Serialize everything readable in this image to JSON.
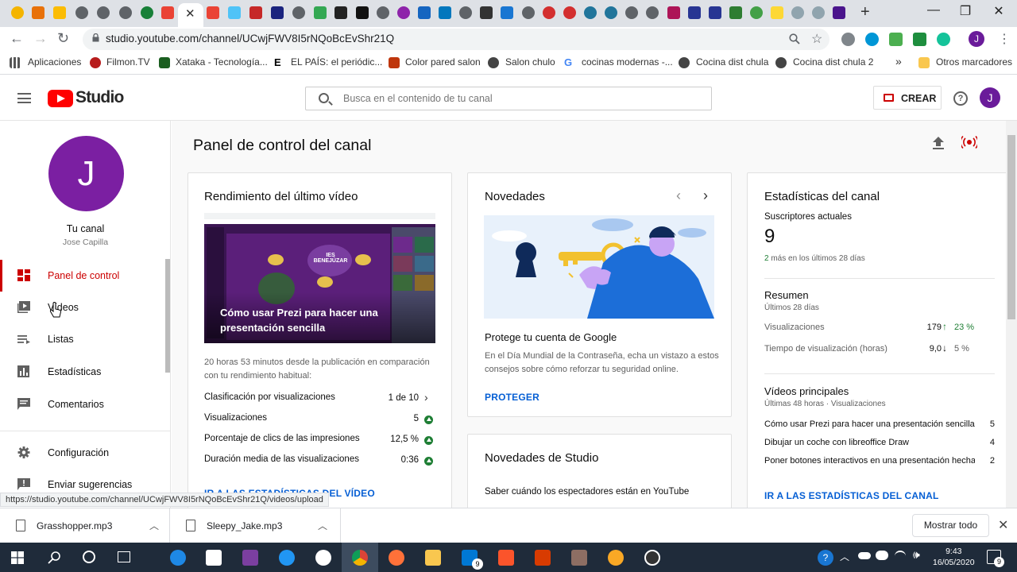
{
  "browser": {
    "url": "studio.youtube.com/channel/UCwjFWV8I5rNQoBcEvShr21Q",
    "bookmarks": [
      {
        "label": "Aplicaciones",
        "icon": "apps-icon"
      },
      {
        "label": "Filmon.TV",
        "icon": "filmon-icon"
      },
      {
        "label": "Xataka - Tecnología...",
        "icon": "xataka-icon"
      },
      {
        "label": "EL PAÍS: el periódic...",
        "icon": "elpais-icon"
      },
      {
        "label": "Color pared salon",
        "icon": "bookmark-icon"
      },
      {
        "label": "Salon chulo",
        "icon": "globe-icon"
      },
      {
        "label": "cocinas modernas -...",
        "icon": "google-icon"
      },
      {
        "label": "Cocina dist chula",
        "icon": "globe-icon"
      },
      {
        "label": "Cocina dist chula 2",
        "icon": "globe-icon"
      }
    ],
    "more_bookmarks": "»",
    "other_bookmarks": "Otros marcadores",
    "profile_initial": "J",
    "status_url": "https://studio.youtube.com/channel/UCwjFWV8I5rNQoBcEvShr21Q/videos/upload"
  },
  "header": {
    "logo_text": "Studio",
    "search_placeholder": "Busca en el contenido de tu canal",
    "create_label": "CREAR",
    "avatar_initial": "J",
    "help_glyph": "?"
  },
  "sidebar": {
    "avatar_initial": "J",
    "channel_label": "Tu canal",
    "owner": "Jose Capilla",
    "items": [
      {
        "label": "Panel de control",
        "icon": "dashboard-icon",
        "active": true
      },
      {
        "label": "Vídeos",
        "icon": "videos-icon",
        "active": false
      },
      {
        "label": "Listas",
        "icon": "playlists-icon",
        "active": false
      },
      {
        "label": "Estadísticas",
        "icon": "analytics-icon",
        "active": false
      },
      {
        "label": "Comentarios",
        "icon": "comments-icon",
        "active": false
      },
      {
        "label": "Configuración",
        "icon": "gear-icon",
        "active": false
      },
      {
        "label": "Enviar sugerencias",
        "icon": "feedback-icon",
        "active": false
      }
    ]
  },
  "main": {
    "title": "Panel de control del canal",
    "latest_video": {
      "title": "Rendimiento del último vídeo",
      "video_title": "Cómo usar Prezi para hacer una presentación sencilla",
      "thumb_text": "IES BENEJÚZAR",
      "since": "20 horas 53 minutos desde la publicación en comparación con tu rendimiento habitual:",
      "metrics": [
        {
          "label": "Clasificación por visualizaciones",
          "value": "1 de 10",
          "indicator": "chevron"
        },
        {
          "label": "Visualizaciones",
          "value": "5",
          "indicator": "up"
        },
        {
          "label": "Porcentaje de clics de las impresiones",
          "value": "12,5 %",
          "indicator": "up"
        },
        {
          "label": "Duración media de las visualizaciones",
          "value": "0:36",
          "indicator": "up"
        }
      ],
      "link": "IR A LAS ESTADÍSTICAS DEL VÍDEO"
    },
    "news": {
      "title": "Novedades",
      "headline": "Protege tu cuenta de Google",
      "body": "En el Día Mundial de la Contraseña, echa un vistazo a estos consejos sobre cómo reforzar tu seguridad online.",
      "cta": "PROTEGER"
    },
    "studio_news": {
      "title": "Novedades de Studio",
      "body": "Saber cuándo los espectadores están en YouTube"
    },
    "stats": {
      "title": "Estadísticas del canal",
      "subs_label": "Suscriptores actuales",
      "subs_value": "9",
      "subs_delta_num": "2",
      "subs_delta_text": " más en los últimos 28 días",
      "summary_title": "Resumen",
      "summary_period": "Últimos 28 días",
      "summary": [
        {
          "label": "Visualizaciones",
          "value": "179",
          "arrow": "↑",
          "change": "23 %",
          "color": "#1e7e34"
        },
        {
          "label": "Tiempo de visualización (horas)",
          "value": "9,0",
          "arrow": "↓",
          "change": "5 %",
          "color": "#606060"
        }
      ],
      "top_title": "Vídeos principales",
      "top_period": "Últimas 48 horas · Visualizaciones",
      "top_videos": [
        {
          "title": "Cómo usar Prezi para hacer una presentación sencilla",
          "views": "5"
        },
        {
          "title": "Dibujar un coche con libreoffice Draw",
          "views": "4"
        },
        {
          "title": "Poner botones interactivos en una presentación hecha ...",
          "views": "2"
        }
      ],
      "link": "IR A LAS ESTADÍSTICAS DEL CANAL"
    }
  },
  "downloads": {
    "items": [
      {
        "name": "Grasshopper.mp3"
      },
      {
        "name": "Sleepy_Jake.mp3"
      }
    ],
    "show_all": "Mostrar todo"
  },
  "taskbar": {
    "time": "9:43",
    "date": "16/05/2020",
    "mail_badge": "9",
    "notification_badge": "9"
  },
  "colors": {
    "accent_red": "#cc0000",
    "link_blue": "#065fd4",
    "avatar_purple": "#7b1fa2",
    "up_green": "#1e7e34"
  }
}
